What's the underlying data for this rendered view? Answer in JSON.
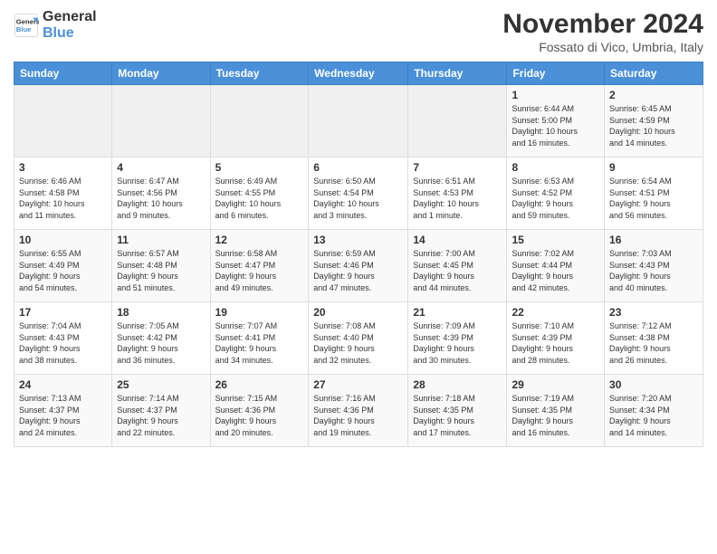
{
  "logo": {
    "line1": "General",
    "line2": "Blue"
  },
  "title": "November 2024",
  "subtitle": "Fossato di Vico, Umbria, Italy",
  "headers": [
    "Sunday",
    "Monday",
    "Tuesday",
    "Wednesday",
    "Thursday",
    "Friday",
    "Saturday"
  ],
  "weeks": [
    [
      {
        "day": "",
        "info": ""
      },
      {
        "day": "",
        "info": ""
      },
      {
        "day": "",
        "info": ""
      },
      {
        "day": "",
        "info": ""
      },
      {
        "day": "",
        "info": ""
      },
      {
        "day": "1",
        "info": "Sunrise: 6:44 AM\nSunset: 5:00 PM\nDaylight: 10 hours\nand 16 minutes."
      },
      {
        "day": "2",
        "info": "Sunrise: 6:45 AM\nSunset: 4:59 PM\nDaylight: 10 hours\nand 14 minutes."
      }
    ],
    [
      {
        "day": "3",
        "info": "Sunrise: 6:46 AM\nSunset: 4:58 PM\nDaylight: 10 hours\nand 11 minutes."
      },
      {
        "day": "4",
        "info": "Sunrise: 6:47 AM\nSunset: 4:56 PM\nDaylight: 10 hours\nand 9 minutes."
      },
      {
        "day": "5",
        "info": "Sunrise: 6:49 AM\nSunset: 4:55 PM\nDaylight: 10 hours\nand 6 minutes."
      },
      {
        "day": "6",
        "info": "Sunrise: 6:50 AM\nSunset: 4:54 PM\nDaylight: 10 hours\nand 3 minutes."
      },
      {
        "day": "7",
        "info": "Sunrise: 6:51 AM\nSunset: 4:53 PM\nDaylight: 10 hours\nand 1 minute."
      },
      {
        "day": "8",
        "info": "Sunrise: 6:53 AM\nSunset: 4:52 PM\nDaylight: 9 hours\nand 59 minutes."
      },
      {
        "day": "9",
        "info": "Sunrise: 6:54 AM\nSunset: 4:51 PM\nDaylight: 9 hours\nand 56 minutes."
      }
    ],
    [
      {
        "day": "10",
        "info": "Sunrise: 6:55 AM\nSunset: 4:49 PM\nDaylight: 9 hours\nand 54 minutes."
      },
      {
        "day": "11",
        "info": "Sunrise: 6:57 AM\nSunset: 4:48 PM\nDaylight: 9 hours\nand 51 minutes."
      },
      {
        "day": "12",
        "info": "Sunrise: 6:58 AM\nSunset: 4:47 PM\nDaylight: 9 hours\nand 49 minutes."
      },
      {
        "day": "13",
        "info": "Sunrise: 6:59 AM\nSunset: 4:46 PM\nDaylight: 9 hours\nand 47 minutes."
      },
      {
        "day": "14",
        "info": "Sunrise: 7:00 AM\nSunset: 4:45 PM\nDaylight: 9 hours\nand 44 minutes."
      },
      {
        "day": "15",
        "info": "Sunrise: 7:02 AM\nSunset: 4:44 PM\nDaylight: 9 hours\nand 42 minutes."
      },
      {
        "day": "16",
        "info": "Sunrise: 7:03 AM\nSunset: 4:43 PM\nDaylight: 9 hours\nand 40 minutes."
      }
    ],
    [
      {
        "day": "17",
        "info": "Sunrise: 7:04 AM\nSunset: 4:43 PM\nDaylight: 9 hours\nand 38 minutes."
      },
      {
        "day": "18",
        "info": "Sunrise: 7:05 AM\nSunset: 4:42 PM\nDaylight: 9 hours\nand 36 minutes."
      },
      {
        "day": "19",
        "info": "Sunrise: 7:07 AM\nSunset: 4:41 PM\nDaylight: 9 hours\nand 34 minutes."
      },
      {
        "day": "20",
        "info": "Sunrise: 7:08 AM\nSunset: 4:40 PM\nDaylight: 9 hours\nand 32 minutes."
      },
      {
        "day": "21",
        "info": "Sunrise: 7:09 AM\nSunset: 4:39 PM\nDaylight: 9 hours\nand 30 minutes."
      },
      {
        "day": "22",
        "info": "Sunrise: 7:10 AM\nSunset: 4:39 PM\nDaylight: 9 hours\nand 28 minutes."
      },
      {
        "day": "23",
        "info": "Sunrise: 7:12 AM\nSunset: 4:38 PM\nDaylight: 9 hours\nand 26 minutes."
      }
    ],
    [
      {
        "day": "24",
        "info": "Sunrise: 7:13 AM\nSunset: 4:37 PM\nDaylight: 9 hours\nand 24 minutes."
      },
      {
        "day": "25",
        "info": "Sunrise: 7:14 AM\nSunset: 4:37 PM\nDaylight: 9 hours\nand 22 minutes."
      },
      {
        "day": "26",
        "info": "Sunrise: 7:15 AM\nSunset: 4:36 PM\nDaylight: 9 hours\nand 20 minutes."
      },
      {
        "day": "27",
        "info": "Sunrise: 7:16 AM\nSunset: 4:36 PM\nDaylight: 9 hours\nand 19 minutes."
      },
      {
        "day": "28",
        "info": "Sunrise: 7:18 AM\nSunset: 4:35 PM\nDaylight: 9 hours\nand 17 minutes."
      },
      {
        "day": "29",
        "info": "Sunrise: 7:19 AM\nSunset: 4:35 PM\nDaylight: 9 hours\nand 16 minutes."
      },
      {
        "day": "30",
        "info": "Sunrise: 7:20 AM\nSunset: 4:34 PM\nDaylight: 9 hours\nand 14 minutes."
      }
    ]
  ]
}
